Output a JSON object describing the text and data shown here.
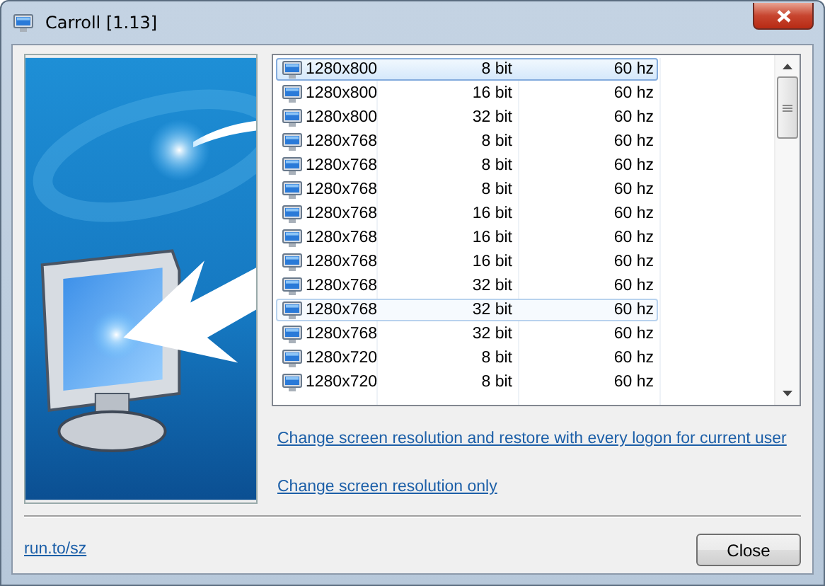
{
  "window": {
    "title": "Carroll [1.13]"
  },
  "resolution_list": {
    "rows": [
      {
        "resolution": "1280x800",
        "depth": "8 bit",
        "refresh": "60 hz",
        "selected": true,
        "focused": false
      },
      {
        "resolution": "1280x800",
        "depth": "16 bit",
        "refresh": "60 hz",
        "selected": false,
        "focused": false
      },
      {
        "resolution": "1280x800",
        "depth": "32 bit",
        "refresh": "60 hz",
        "selected": false,
        "focused": false
      },
      {
        "resolution": "1280x768",
        "depth": "8 bit",
        "refresh": "60 hz",
        "selected": false,
        "focused": false
      },
      {
        "resolution": "1280x768",
        "depth": "8 bit",
        "refresh": "60 hz",
        "selected": false,
        "focused": false
      },
      {
        "resolution": "1280x768",
        "depth": "8 bit",
        "refresh": "60 hz",
        "selected": false,
        "focused": false
      },
      {
        "resolution": "1280x768",
        "depth": "16 bit",
        "refresh": "60 hz",
        "selected": false,
        "focused": false
      },
      {
        "resolution": "1280x768",
        "depth": "16 bit",
        "refresh": "60 hz",
        "selected": false,
        "focused": false
      },
      {
        "resolution": "1280x768",
        "depth": "16 bit",
        "refresh": "60 hz",
        "selected": false,
        "focused": false
      },
      {
        "resolution": "1280x768",
        "depth": "32 bit",
        "refresh": "60 hz",
        "selected": false,
        "focused": false
      },
      {
        "resolution": "1280x768",
        "depth": "32 bit",
        "refresh": "60 hz",
        "selected": false,
        "focused": true
      },
      {
        "resolution": "1280x768",
        "depth": "32 bit",
        "refresh": "60 hz",
        "selected": false,
        "focused": false
      },
      {
        "resolution": "1280x720",
        "depth": "8 bit",
        "refresh": "60 hz",
        "selected": false,
        "focused": false
      },
      {
        "resolution": "1280x720",
        "depth": "8 bit",
        "refresh": "60 hz",
        "selected": false,
        "focused": false
      }
    ]
  },
  "links": [
    "Change screen resolution and restore with every logon for current user",
    "Change screen resolution only"
  ],
  "footer": {
    "link": "run.to/sz",
    "button": "Close"
  }
}
